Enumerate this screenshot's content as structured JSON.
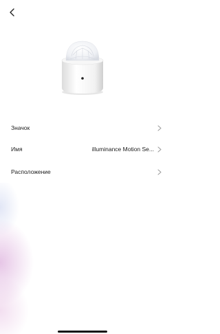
{
  "header": {
    "back_icon": "chevron-left-icon"
  },
  "device": {
    "image_icon": "motion-sensor-image"
  },
  "settings": {
    "rows": [
      {
        "label": "Значок",
        "value": "",
        "chevron_icon": "chevron-right-icon"
      },
      {
        "label": "Имя",
        "value": "illuminance Motion Se...",
        "chevron_icon": "chevron-right-icon"
      },
      {
        "label": "Расположение",
        "value": "",
        "chevron_icon": "chevron-right-icon"
      }
    ]
  },
  "colors": {
    "background": "#ffffff",
    "text": "#1c1c1c",
    "chevron": "#9a9a9a",
    "gradient_pink": "#d296d2",
    "gradient_blue": "#bec8eb"
  }
}
